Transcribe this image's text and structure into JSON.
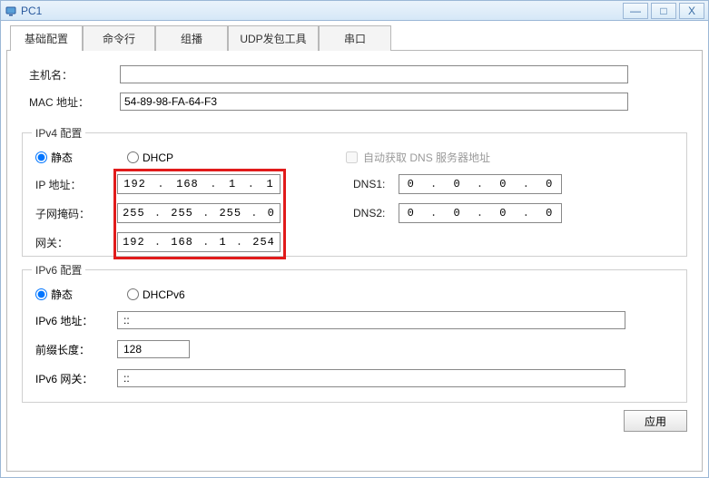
{
  "window": {
    "title": "PC1"
  },
  "tabs": {
    "items": [
      {
        "label": "基础配置"
      },
      {
        "label": "命令行"
      },
      {
        "label": "组播"
      },
      {
        "label": "UDP发包工具"
      },
      {
        "label": "串口"
      }
    ]
  },
  "basic": {
    "hostname_label": "主机名：",
    "hostname_value": "",
    "mac_label": "MAC 地址：",
    "mac_value": "54-89-98-FA-64-F3"
  },
  "ipv4": {
    "legend": "IPv4 配置",
    "static_label": "静态",
    "dhcp_label": "DHCP",
    "auto_dns_label": "自动获取 DNS 服务器地址",
    "ip_label": "IP 地址：",
    "ip_value": [
      "192",
      "168",
      "1",
      "1"
    ],
    "mask_label": "子网掩码：",
    "mask_value": [
      "255",
      "255",
      "255",
      "0"
    ],
    "gw_label": "网关：",
    "gw_value": [
      "192",
      "168",
      "1",
      "254"
    ],
    "dns1_label": "DNS1:",
    "dns1_value": [
      "0",
      "0",
      "0",
      "0"
    ],
    "dns2_label": "DNS2:",
    "dns2_value": [
      "0",
      "0",
      "0",
      "0"
    ]
  },
  "ipv6": {
    "legend": "IPv6 配置",
    "static_label": "静态",
    "dhcp_label": "DHCPv6",
    "addr_label": "IPv6 地址：",
    "addr_value": "::",
    "prefix_label": "前缀长度：",
    "prefix_value": "128",
    "gw_label": "IPv6 网关：",
    "gw_value": "::"
  },
  "footer": {
    "apply_label": "应用"
  }
}
